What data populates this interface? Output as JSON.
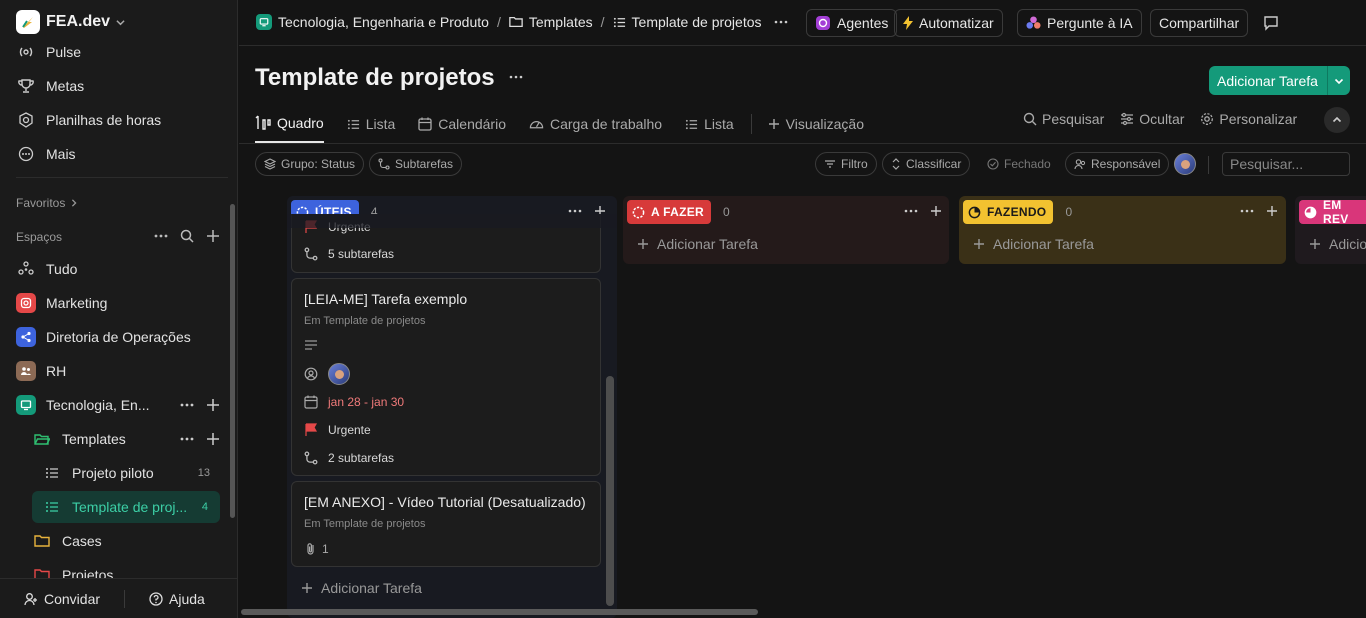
{
  "workspace": {
    "name": "FEA.dev"
  },
  "sidebar": {
    "nav": [
      {
        "label": "Pulse",
        "icon": "pulse-icon"
      },
      {
        "label": "Metas",
        "icon": "trophy-icon"
      },
      {
        "label": "Planilhas de horas",
        "icon": "timesheet-icon"
      },
      {
        "label": "Mais",
        "icon": "more-icon"
      }
    ],
    "favorites_label": "Favoritos",
    "spaces_label": "Espaços",
    "spaces": [
      {
        "label": "Tudo",
        "icon": "all-icon"
      },
      {
        "label": "Marketing",
        "icon": "instagram-icon",
        "color": "#e54848"
      },
      {
        "label": "Diretoria de Operações",
        "icon": "share-icon",
        "color": "#3d63dd"
      },
      {
        "label": "RH",
        "icon": "people-icon",
        "color": "#8c6a55"
      },
      {
        "label": "Tecnologia, En...",
        "icon": "monitor-icon",
        "color": "#149a7a"
      }
    ],
    "folders": [
      {
        "label": "Templates",
        "icon": "folder-open-icon",
        "color": "#2fbf71"
      },
      {
        "label": "Cases",
        "icon": "folder-icon",
        "color": "#e8b33c"
      },
      {
        "label": "Projetos",
        "icon": "folder-icon",
        "color": "#e54848"
      }
    ],
    "lists": [
      {
        "label": "Projeto piloto",
        "count": "13"
      },
      {
        "label": "Template de proj...",
        "count": "4"
      }
    ],
    "invite_label": "Convidar",
    "help_label": "Ajuda"
  },
  "topbar": {
    "breadcrumbs": [
      "Tecnologia, Engenharia e Produto",
      "Templates",
      "Template de projetos"
    ],
    "agents_label": "Agentes",
    "automate_label": "Automatizar",
    "ask_ai_label": "Pergunte à IA",
    "share_label": "Compartilhar"
  },
  "page": {
    "title": "Template de projetos",
    "add_task_label": "Adicionar Tarefa"
  },
  "tabs": [
    {
      "label": "Quadro",
      "icon": "board-icon"
    },
    {
      "label": "Lista",
      "icon": "list-icon"
    },
    {
      "label": "Calendário",
      "icon": "calendar-icon"
    },
    {
      "label": "Carga de trabalho",
      "icon": "gauge-icon"
    },
    {
      "label": "Lista",
      "icon": "list-icon"
    }
  ],
  "add_view_label": "Visualização",
  "view_actions": {
    "search": "Pesquisar",
    "hide": "Ocultar",
    "customize": "Personalizar"
  },
  "filters": {
    "group": "Grupo: Status",
    "subtasks": "Subtarefas",
    "filter": "Filtro",
    "sort": "Classificar",
    "closed": "Fechado",
    "assignee": "Responsável",
    "search_placeholder": "Pesquisar..."
  },
  "columns": [
    {
      "status": "ÚTEIS",
      "count": "4",
      "color": "#3d63dd"
    },
    {
      "status": "A FAZER",
      "count": "0",
      "color": "#d73a3a"
    },
    {
      "status": "FAZENDO",
      "count": "0",
      "color": "#f2c230"
    },
    {
      "status": "EM REV",
      "color": "#d9367a"
    }
  ],
  "column_add_label": "Adicionar Tarefa",
  "column_add_label_partial": "Adicio",
  "cards": [
    {
      "priority": "Urgente",
      "subtasks": "5 subtarefas"
    },
    {
      "title": "[LEIA-ME] Tarefa exemplo",
      "location": "Em Template de projetos",
      "dates": "jan 28 - jan 30",
      "priority": "Urgente",
      "subtasks": "2 subtarefas"
    },
    {
      "title": "[EM ANEXO] - Vídeo Tutorial (Desatualizado)",
      "location": "Em Template de projetos",
      "attachments": "1"
    }
  ]
}
